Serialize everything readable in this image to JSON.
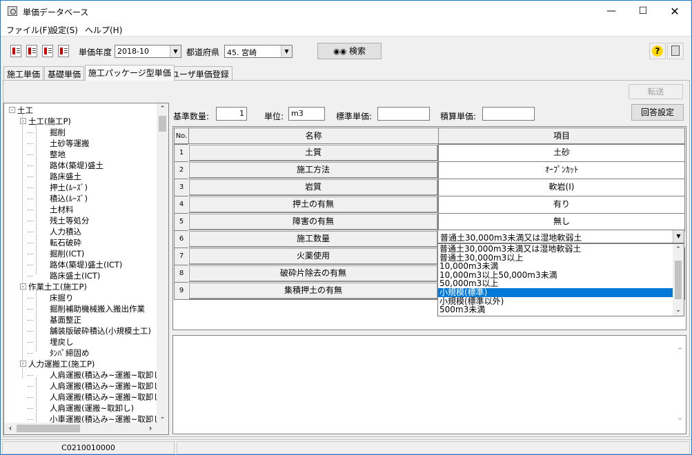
{
  "window": {
    "title": "単価データベース"
  },
  "menu": {
    "file": "ファイル(F)",
    "settings": "設定(S)",
    "help": "ヘルプ(H)"
  },
  "toolbar": {
    "year_label": "単価年度",
    "year_value": "2018-10",
    "pref_label": "都道府県",
    "pref_value": "45. 宮崎",
    "search_label": "検索",
    "help_glyph": "?"
  },
  "tabs": [
    "施工単価",
    "基礎単価",
    "施工パッケージ型単価",
    "ユーザ単価登録"
  ],
  "transfer_label": "転送",
  "tree": [
    {
      "label": "土工",
      "level": 0,
      "exp": "-"
    },
    {
      "label": "土工(施工P)",
      "level": 1,
      "exp": "-"
    },
    {
      "label": "掘削",
      "level": 2
    },
    {
      "label": "土砂等運搬",
      "level": 2
    },
    {
      "label": "整地",
      "level": 2
    },
    {
      "label": "路体(築堤)盛土",
      "level": 2
    },
    {
      "label": "路床盛土",
      "level": 2
    },
    {
      "label": "押土(ﾙｰｽﾞ)",
      "level": 2
    },
    {
      "label": "積込(ﾙｰｽﾞ)",
      "level": 2
    },
    {
      "label": "土材料",
      "level": 2
    },
    {
      "label": "残土等処分",
      "level": 2
    },
    {
      "label": "人力積込",
      "level": 2
    },
    {
      "label": "転石破砕",
      "level": 2
    },
    {
      "label": "掘削(ICT)",
      "level": 2
    },
    {
      "label": "路体(築堤)盛土(ICT)",
      "level": 2
    },
    {
      "label": "路床盛土(ICT)",
      "level": 2
    },
    {
      "label": "作業土工(施工P)",
      "level": 1,
      "exp": "-"
    },
    {
      "label": "床掘り",
      "level": 2
    },
    {
      "label": "掘削補助機械搬入搬出作業",
      "level": 2
    },
    {
      "label": "基面整正",
      "level": 2
    },
    {
      "label": "舗装版破砕積込(小規模土工)",
      "level": 2
    },
    {
      "label": "埋戻し",
      "level": 2
    },
    {
      "label": "ﾀﾝﾊﾟ締固め",
      "level": 2
    },
    {
      "label": "人力運搬工(施工P)",
      "level": 1,
      "exp": "-"
    },
    {
      "label": "人肩運搬(積込み~運搬~取卸し",
      "level": 2
    },
    {
      "label": "人肩運搬(積込み~運搬~取卸し",
      "level": 2
    },
    {
      "label": "人肩運搬(積込み~運搬~取卸し",
      "level": 2
    },
    {
      "label": "人肩運搬(運搬~取卸し)",
      "level": 2
    },
    {
      "label": "小車運搬(積込み~運搬~取卸し",
      "level": 2
    }
  ],
  "params": {
    "base_qty_label": "基準数量:",
    "base_qty_value": "1",
    "unit_label": "単位:",
    "unit_value": "m3",
    "std_price_label": "標準単価:",
    "std_price_value": "",
    "est_price_label": "積算単価:",
    "est_price_value": "",
    "answer_button": "回答設定"
  },
  "grid": {
    "headers": [
      "No.",
      "名称",
      "項目"
    ],
    "rows": [
      {
        "no": "1",
        "name": "土質",
        "value": "土砂"
      },
      {
        "no": "2",
        "name": "施工方法",
        "value": "ｵｰﾌﾟﾝｶｯﾄ"
      },
      {
        "no": "3",
        "name": "岩質",
        "value": "軟岩(I)"
      },
      {
        "no": "4",
        "name": "押土の有無",
        "value": "有り"
      },
      {
        "no": "5",
        "name": "障害の有無",
        "value": "無し"
      },
      {
        "no": "6",
        "name": "施工数量",
        "value": "普通土30,000m3未満又は湿地軟弱土"
      },
      {
        "no": "7",
        "name": "火薬使用",
        "value": ""
      },
      {
        "no": "8",
        "name": "破砕片除去の有無",
        "value": ""
      },
      {
        "no": "9",
        "name": "集積押土の有無",
        "value": ""
      }
    ]
  },
  "dropdown": {
    "options": [
      "普通土30,000m3未満又は湿地軟弱土",
      "普通土30,000m3以上",
      "10,000m3未満",
      "10,000m3以上50,000m3未満",
      "50,000m3以上",
      "小規模(標準)",
      "小規模(標準以外)",
      "500m3未満"
    ],
    "selected_index": 5
  },
  "status": {
    "code": "C0210010000"
  },
  "colors": {
    "selection": "#0078d7",
    "title_icon_area": "#ffffff"
  }
}
